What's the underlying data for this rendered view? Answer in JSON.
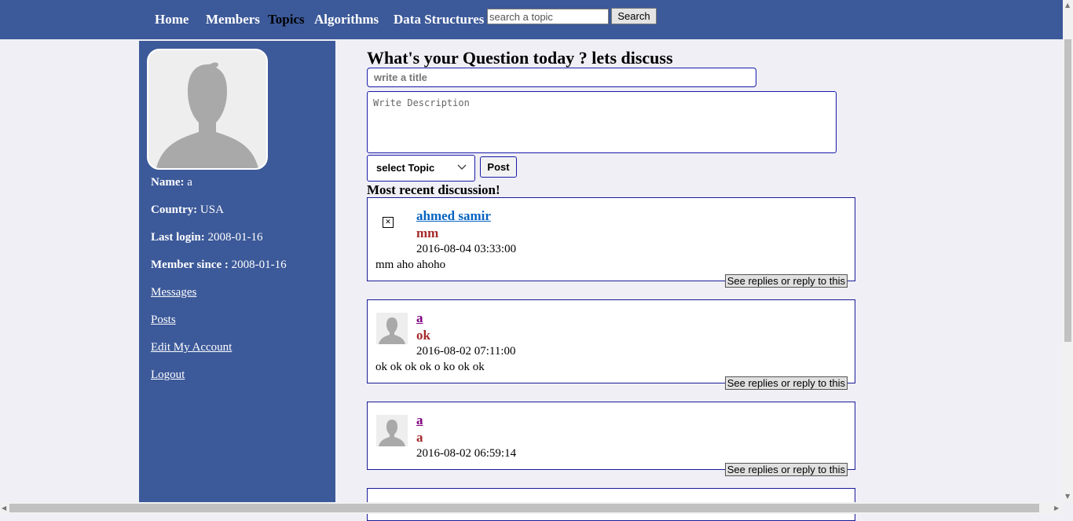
{
  "nav": {
    "items": [
      "Home",
      "Members",
      "Topics",
      "Algorithms",
      "Data Structures"
    ],
    "active": "Topics"
  },
  "search": {
    "placeholder": "search a topic",
    "button_label": "Search"
  },
  "profile": {
    "name_label": "Name:",
    "name_value": "a",
    "country_label": "Country:",
    "country_value": "USA",
    "last_login_label": "Last login:",
    "last_login_value": "2008-01-16",
    "member_since_label": "Member since :",
    "member_since_value": "2008-01-16"
  },
  "sidebar_links": [
    "Messages",
    "Posts",
    "Edit My Account",
    "Logout"
  ],
  "compose": {
    "heading": "What's your Question today ? lets discuss",
    "title_placeholder": "write a title",
    "description_placeholder": "Write Description",
    "topic_select_value": "select Topic",
    "post_button": "Post"
  },
  "feed": {
    "heading": "Most recent discussion!",
    "reply_label": "See replies or reply to this",
    "posts": [
      {
        "author": "ahmed samir",
        "title": "mm",
        "date": "2016-08-04 03:33:00",
        "body": "mm aho ahoho",
        "avatar": "broken-image-icon"
      },
      {
        "author": "a",
        "title": "ok",
        "date": "2016-08-02 07:11:00",
        "body": "ok ok ok ok o ko ok ok",
        "avatar": "user-silhouette-icon"
      },
      {
        "author": "a",
        "title": "a",
        "date": "2016-08-02 06:59:14",
        "body": "",
        "avatar": "user-silhouette-icon"
      }
    ]
  },
  "colors": {
    "nav_bg": "#3c5999",
    "page_bg": "#efeff5",
    "card_border": "#1a1a99",
    "post_title": "#a52a2a",
    "author_visited": "#800080",
    "author_link": "#0563c1"
  }
}
